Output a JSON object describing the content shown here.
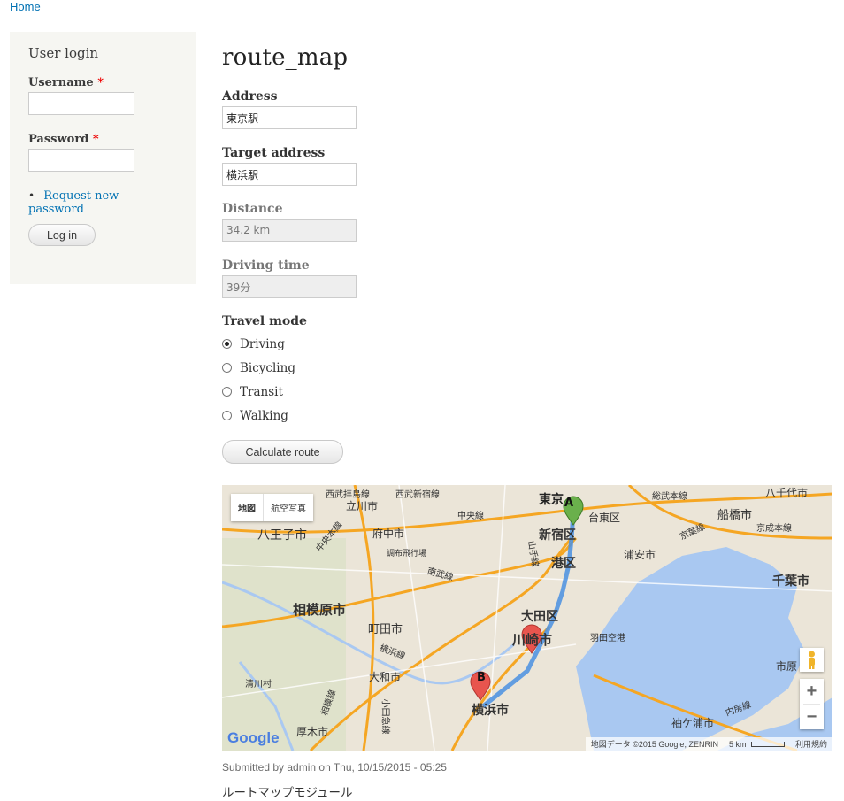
{
  "breadcrumb": {
    "home": "Home"
  },
  "sidebar": {
    "title": "User login",
    "username_label": "Username",
    "password_label": "Password",
    "required_mark": "*",
    "request_password": "Request new password",
    "login_button": "Log in"
  },
  "page": {
    "title": "route_map",
    "address_label": "Address",
    "address_value": "東京駅",
    "target_label": "Target address",
    "target_value": "横浜駅",
    "distance_label": "Distance",
    "distance_value": "34.2 km",
    "time_label": "Driving time",
    "time_value": "39分",
    "travel_mode_label": "Travel mode",
    "modes": [
      {
        "label": "Driving",
        "selected": true
      },
      {
        "label": "Bicycling",
        "selected": false
      },
      {
        "label": "Transit",
        "selected": false
      },
      {
        "label": "Walking",
        "selected": false
      }
    ],
    "calculate_button": "Calculate route"
  },
  "map": {
    "type_map": "地図",
    "type_satellite": "航空写真",
    "zoom_in": "+",
    "zoom_out": "−",
    "attribution": "地図データ ©2015 Google, ZENRIN",
    "scale": "5 km",
    "terms": "利用規約",
    "google": "Google",
    "marker_a": "A",
    "marker_b": "B",
    "labels": {
      "tokyo": "東京",
      "shinjuku": "新宿区",
      "minato": "港区",
      "taito": "台東区",
      "urayasu": "浦安市",
      "funabashi": "船橋市",
      "chiba": "千葉市",
      "hachioji": "八王子市",
      "fuchu": "府中市",
      "sagamihara": "相模原市",
      "machida": "町田市",
      "yamato": "大和市",
      "ota": "大田区",
      "kawasaki": "川崎市",
      "haneda": "羽田空港",
      "yokohama": "横浜市",
      "atsugi": "厚木市",
      "sodegaura": "袖ケ浦市",
      "ichihara": "市原",
      "chofu": "調布飛行場",
      "tachikawa": "立川市",
      "yachiyo": "八千代市",
      "kiyokawa": "清川村",
      "chuo_line": "中央線",
      "seibu_haijima": "西武拝島線",
      "seibu_shinjuku": "西武新宿線",
      "sobu": "総武本線",
      "keiyo": "京葉線",
      "keisei": "京成本線",
      "nanbu": "南武線",
      "yokohama_line": "横浜線",
      "sagami": "相模線",
      "odakyu": "小田急線",
      "uchibo": "内房線",
      "yamanote": "山手線",
      "chuo_main": "中央本線"
    }
  },
  "footer": {
    "submitted": "Submitted by admin on Thu, 10/15/2015 - 05:25",
    "body": "ルートマップモジュール"
  }
}
